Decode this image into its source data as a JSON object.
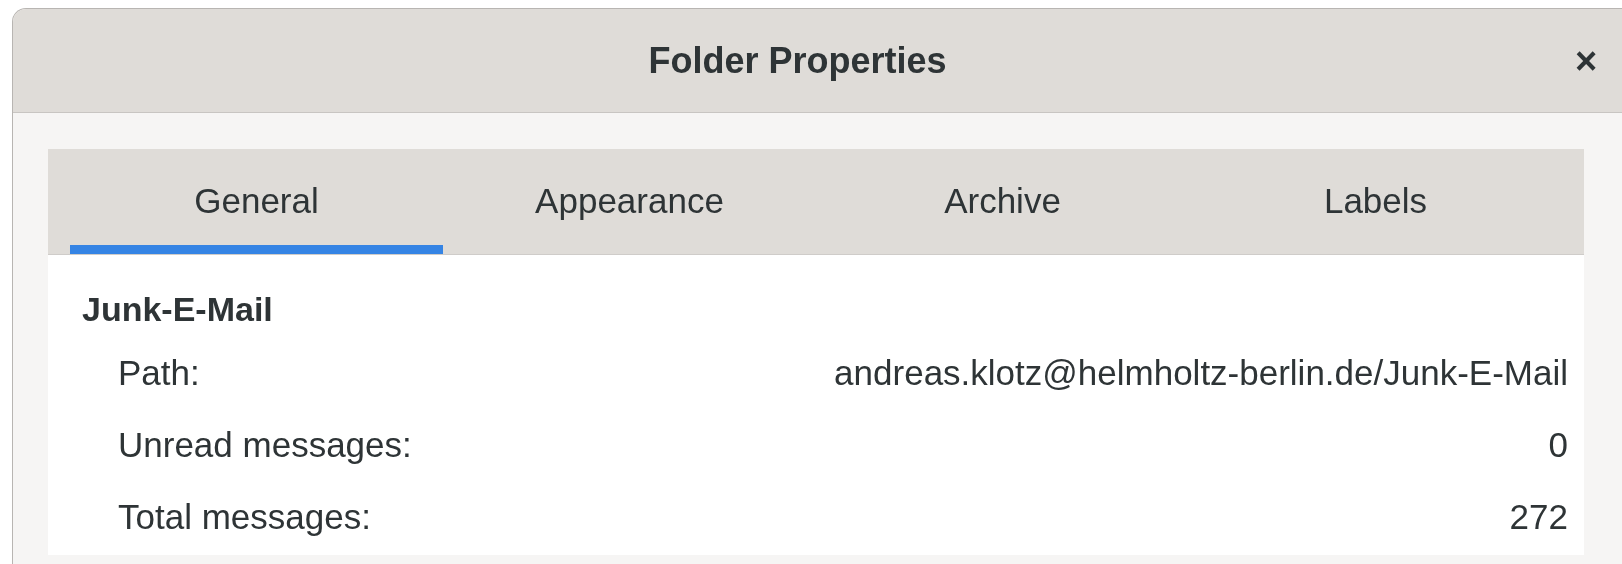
{
  "window": {
    "title": "Folder Properties",
    "close": "×"
  },
  "tabs": [
    {
      "label": "General",
      "selected": true
    },
    {
      "label": "Appearance",
      "selected": false
    },
    {
      "label": "Archive",
      "selected": false
    },
    {
      "label": "Labels",
      "selected": false
    }
  ],
  "folder_name": "Junk-E-Mail",
  "properties": [
    {
      "label": "Path:",
      "value": "andreas.klotz@helmholtz-berlin.de/Junk-E-Mail"
    },
    {
      "label": "Unread messages:",
      "value": "0"
    },
    {
      "label": "Total messages:",
      "value": "272"
    }
  ]
}
